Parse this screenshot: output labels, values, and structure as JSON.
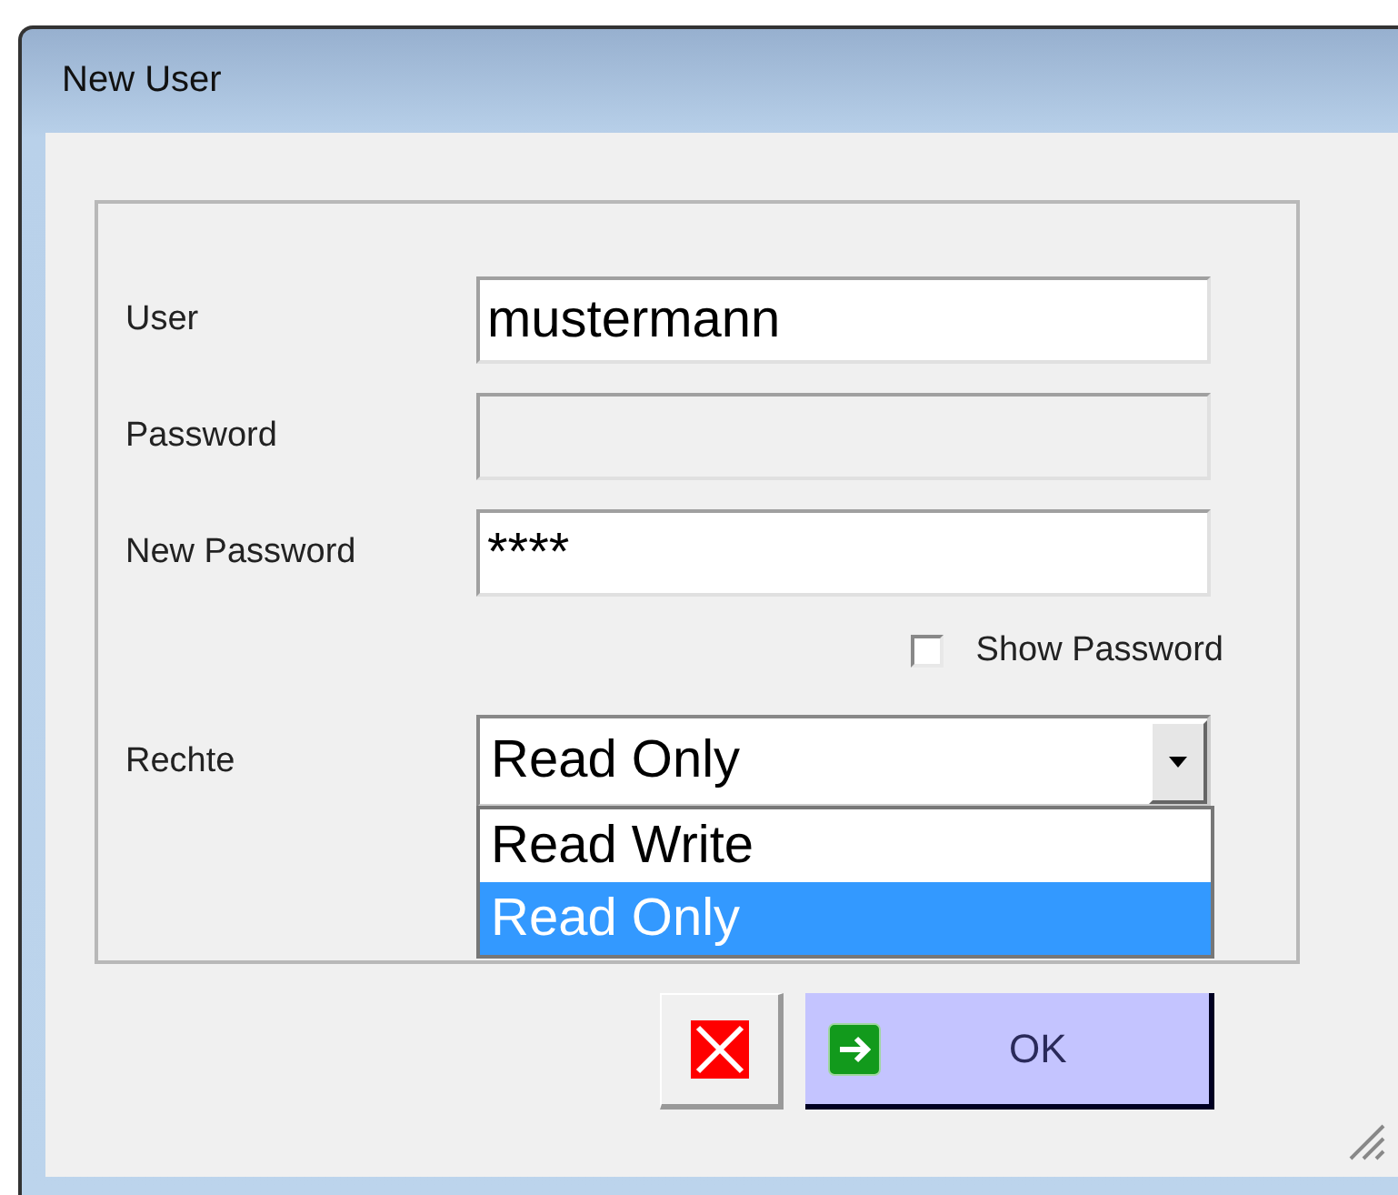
{
  "window": {
    "title": "New User"
  },
  "fields": [
    {
      "label": "User",
      "value": "mustermann",
      "disabled": false
    },
    {
      "label": "Password",
      "disabled": true
    },
    {
      "label": "New Password",
      "value": "****",
      "disabled": false
    }
  ],
  "show_password": {
    "label": "Show Password",
    "checked": false
  },
  "rights": {
    "label": "Rechte",
    "value": "Read Only",
    "expanded": true,
    "options": [
      {
        "label": "Read Write",
        "selected": false
      },
      {
        "label": "Read Only",
        "selected": true
      }
    ]
  },
  "buttons": [
    {
      "kind": "cancel"
    },
    {
      "kind": "ok",
      "label": "OK"
    }
  ]
}
